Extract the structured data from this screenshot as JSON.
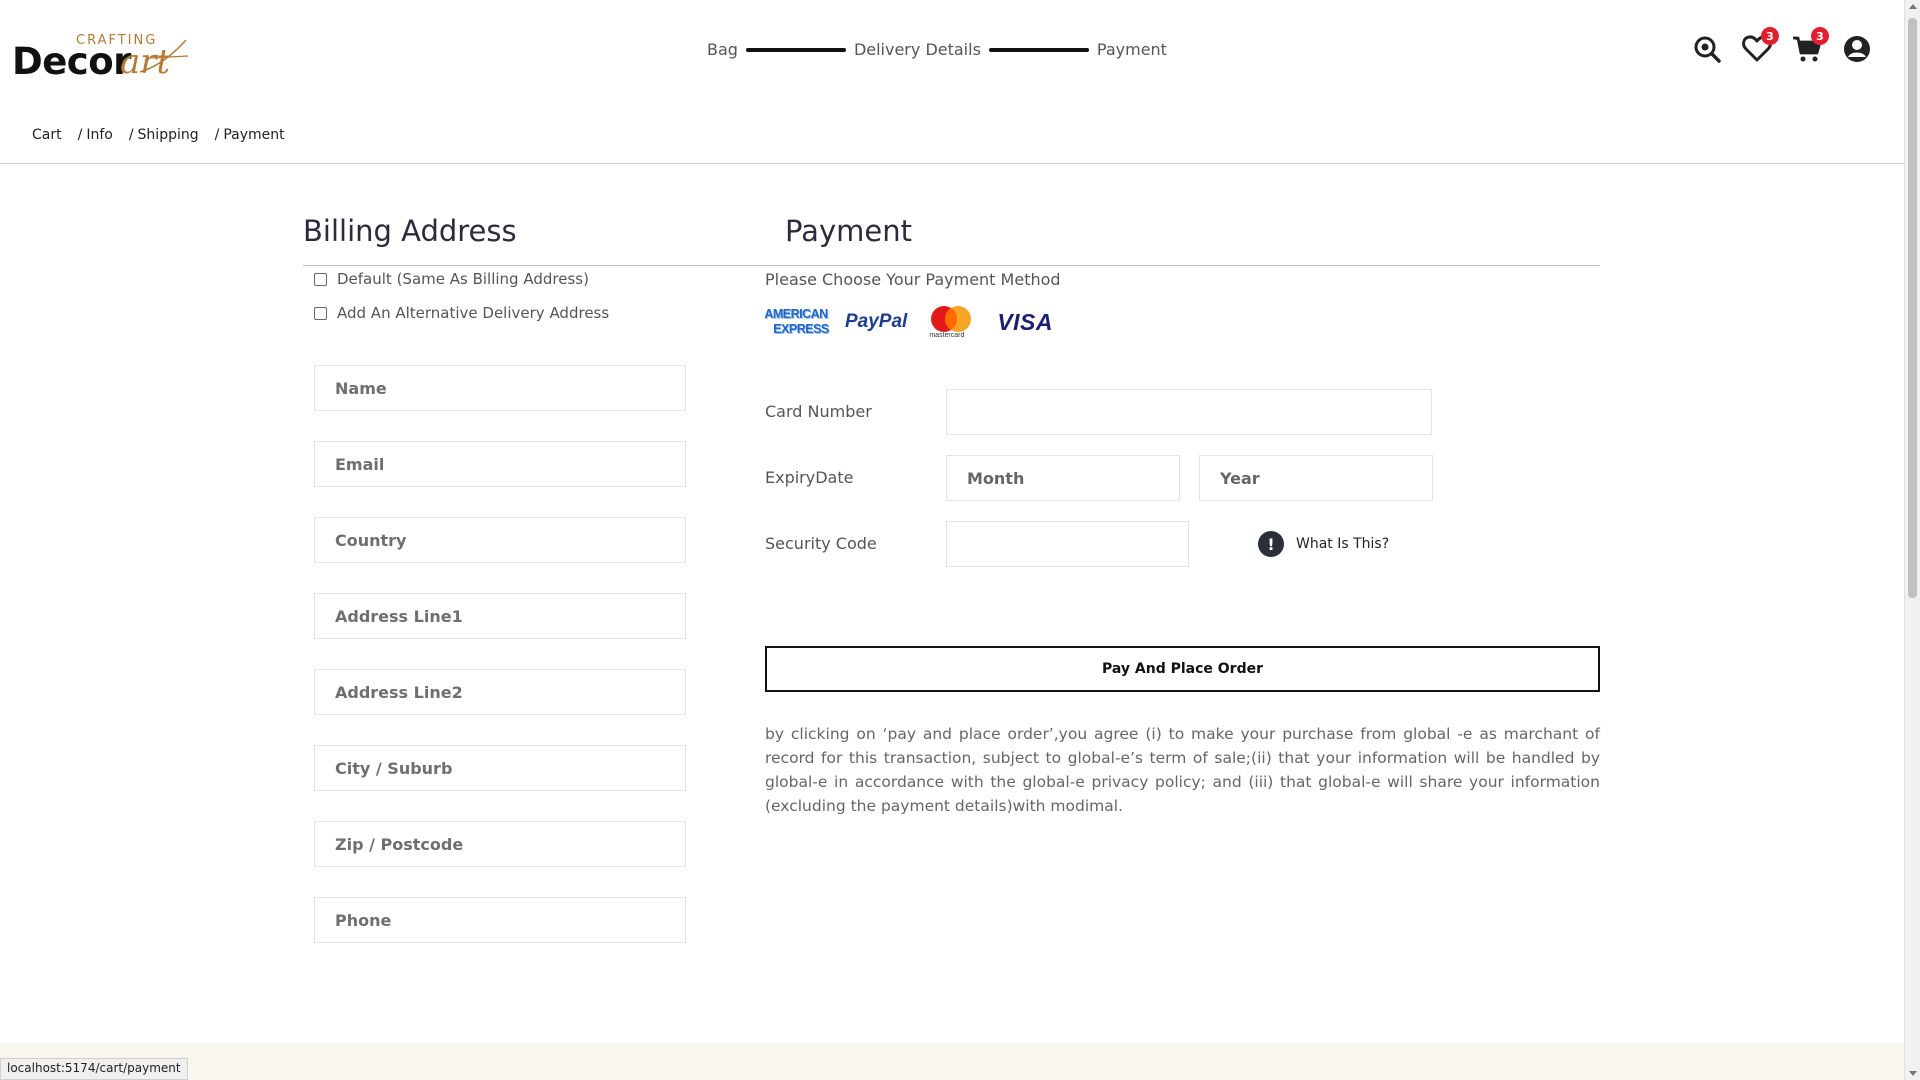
{
  "brand": {
    "crafting": "CRAFTING",
    "decor": "Decor",
    "art": "art"
  },
  "stepper": {
    "step1": "Bag",
    "step2": "Delivery Details",
    "step3": "Payment"
  },
  "header_icons": {
    "wishlist_count": "3",
    "cart_count": "3",
    "icons": [
      "search-icon",
      "heart-icon",
      "cart-icon",
      "user-icon"
    ]
  },
  "breadcrumb": {
    "cart": "Cart",
    "info": "Info",
    "shipping": "Shipping",
    "payment": "Payment",
    "separator": "/"
  },
  "billing": {
    "title": "Billing Address",
    "default_label": "Default (Same As Billing Address)",
    "alternative_label": "Add An Alternative Delivery Address",
    "fields": {
      "name": "Name",
      "email": "Email",
      "country": "Country",
      "address1": "Address Line1",
      "address2": "Address Line2",
      "city": "City / Suburb",
      "zip": "Zip / Postcode",
      "phone": "Phone"
    }
  },
  "payment": {
    "title": "Payment",
    "subtitle": "Please Choose Your Payment Method",
    "cards": {
      "amex_top": "AMERICAN",
      "amex_bottom": "EXPRESS",
      "paypal": "PayPal",
      "mastercard": "mastercard",
      "visa": "VISA"
    },
    "card_number_label": "Card Number",
    "expiry_label": "ExpiryDate",
    "month_placeholder": "Month",
    "year_placeholder": "Year",
    "security_label": "Security Code",
    "what_is_this": "What Is This?",
    "place_order": "Pay And Place Order",
    "terms": "by clicking on ‘pay and place order’,you agree (i) to make your purchase from global -e as marchant of record for this transaction, subject to global-e’s term of sale;(ii) that your information will be handled by global-e in accordance with the global-e privacy policy; and (iii) that global-e will share your information (excluding the payment details)with modimal."
  },
  "status_bar": {
    "url": "localhost:5174/cart/payment"
  },
  "colors": {
    "accent_brown": "#b47a35",
    "badge_red": "#e0202f",
    "footer_cream": "#f8f6ef"
  }
}
